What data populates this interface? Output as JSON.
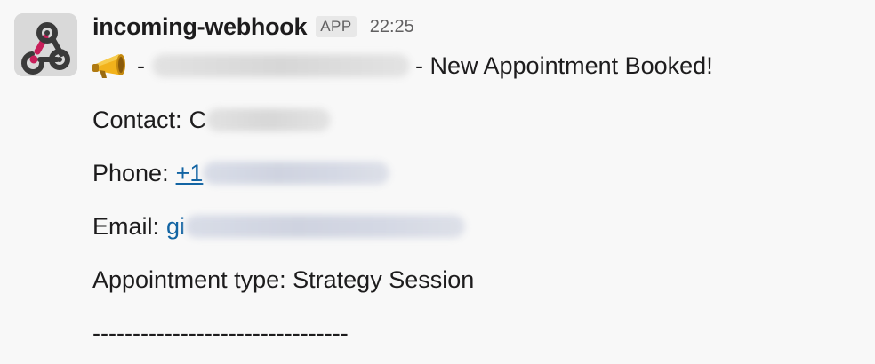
{
  "message": {
    "avatar_icon": "webhook-icon",
    "sender": "incoming-webhook",
    "badge": "APP",
    "timestamp": "22:25",
    "line1": {
      "emoji": "megaphone-icon",
      "prefix": "-",
      "suffix": "- New Appointment Booked!"
    },
    "contact": {
      "label": "Contact:",
      "visible_start": "C"
    },
    "phone": {
      "label": "Phone:",
      "visible_start": "+1"
    },
    "email": {
      "label": "Email:",
      "visible_start": "gi"
    },
    "appointment": "Appointment type: Strategy Session",
    "divider": "--------------------------------"
  },
  "colors": {
    "link": "#1264a3",
    "background": "#f8f8f8",
    "webhook_accent": "#e01e5a"
  }
}
